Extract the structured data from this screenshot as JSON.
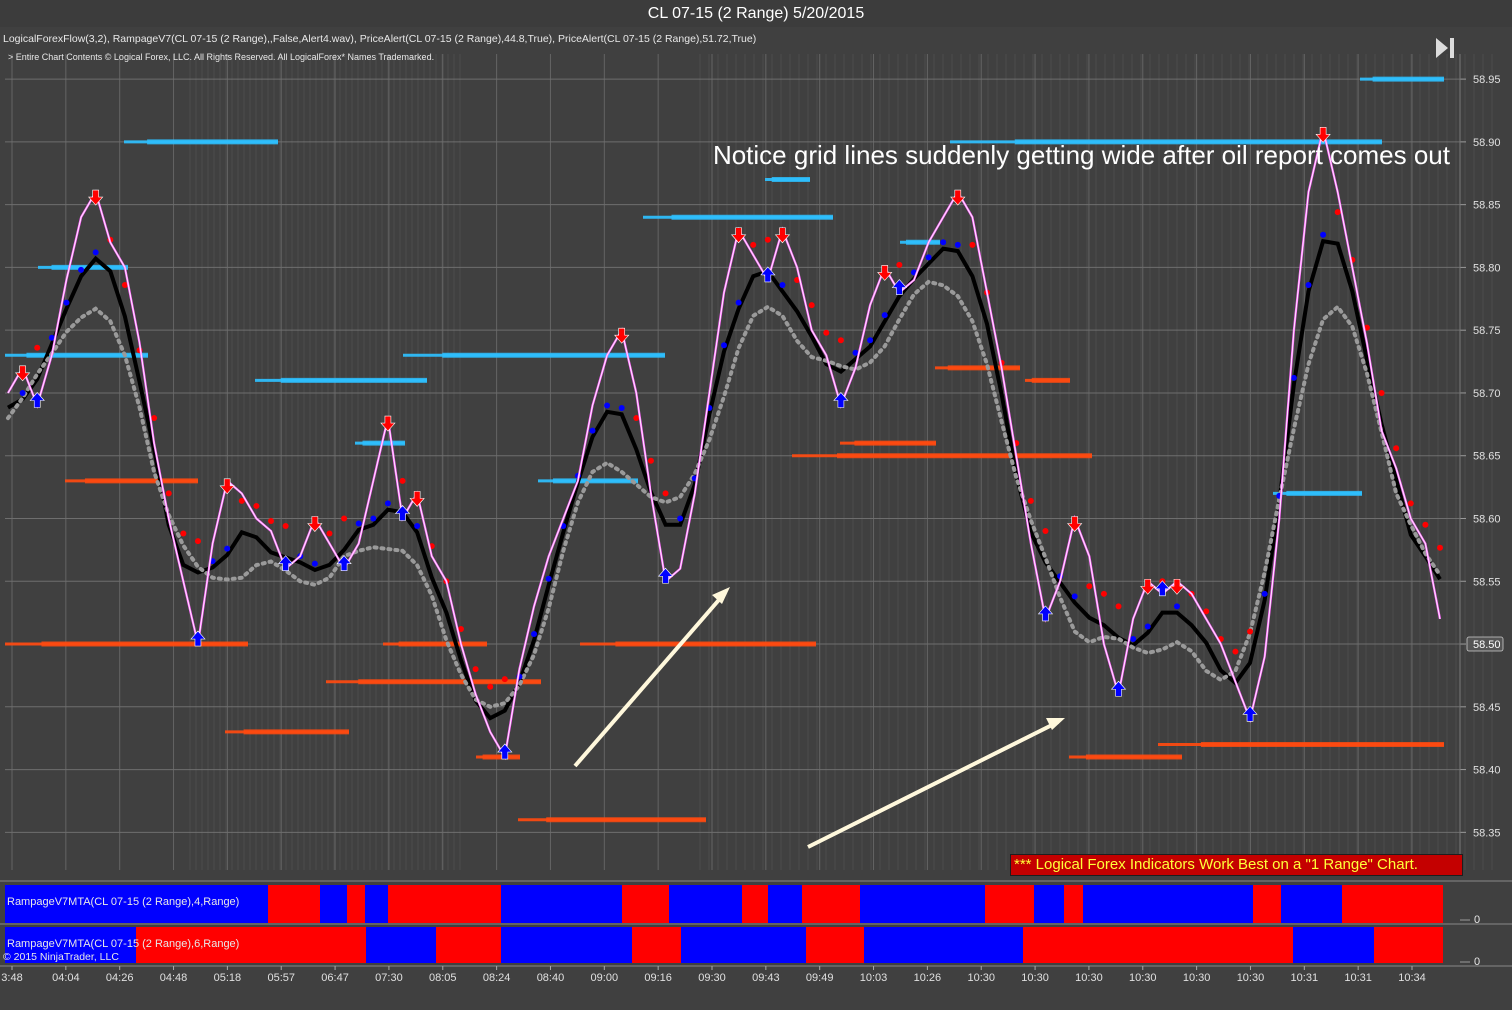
{
  "window": {
    "title": "CL 07-15 (2 Range)  5/20/2015"
  },
  "header": {
    "indicator_line": "LogicalForexFlow(3,2), RampageV7(CL 07-15 (2 Range),,False,Alert4.wav), PriceAlert(CL 07-15 (2 Range),44.8,True), PriceAlert(CL 07-15 (2 Range),51.72,True)",
    "copyright_line": "> Entire Chart Contents © Logical Forex, LLC. All Rights Reserved. All LogicalForex* Names Trademarked."
  },
  "annotation": "Notice grid lines suddenly getting wide after oil report comes out",
  "promo_banner": "*** Logical Forex Indicators Work Best on a \"1 Range\" Chart.",
  "panels": {
    "mta4_label": "RampageV7MTA(CL 07-15 (2 Range),4,Range)",
    "mta6_label": "RampageV7MTA(CL 07-15 (2 Range),6,Range)",
    "ninja_credit": "© 2015 NinjaTrader, LLC",
    "zero_label_top": "0",
    "zero_label_bottom": "0"
  },
  "colors": {
    "background": "#404040",
    "grid": "#6e6e6e",
    "price": "#ff66ff",
    "bull": "#0000ff",
    "bear": "#ff0000",
    "trend": "#000000",
    "level_blue": "#2ec0ff",
    "level_red": "#ff4a10",
    "arrow_annotation": "#fff8dc"
  },
  "chart_data": {
    "type": "line",
    "title": "CL 07-15 (2 Range)  5/20/2015",
    "ylim": [
      58.32,
      58.97
    ],
    "y_ticks": [
      58.35,
      58.4,
      58.45,
      58.5,
      58.55,
      58.6,
      58.65,
      58.7,
      58.75,
      58.8,
      58.85,
      58.9,
      58.95
    ],
    "y_tick_labels": [
      "58.35",
      "58.40",
      "58.45",
      "58.50",
      "58.55",
      "58.60",
      "58.65",
      "58.70",
      "58.75",
      "58.80",
      "58.85",
      "58.90",
      "58.95"
    ],
    "current_price": "58.50",
    "x_ticks": [
      "3:48",
      "04:04",
      "04:26",
      "04:48",
      "05:18",
      "05:57",
      "06:47",
      "07:30",
      "08:05",
      "08:24",
      "08:40",
      "09:00",
      "09:16",
      "09:30",
      "09:43",
      "09:49",
      "10:03",
      "10:26",
      "10:30",
      "10:30",
      "10:30",
      "10:30",
      "10:30",
      "10:30",
      "10:31",
      "10:31",
      "10:34"
    ],
    "series": [
      {
        "name": "",
        "values": [
          58.7,
          58.72,
          58.69,
          58.73,
          58.79,
          58.84,
          58.86,
          58.82,
          58.8,
          58.74,
          58.66,
          58.6,
          58.55,
          58.5,
          58.58,
          58.63,
          58.62,
          58.6,
          58.59,
          58.56,
          58.57,
          58.6,
          58.58,
          58.56,
          58.58,
          58.63,
          58.68,
          58.6,
          58.62,
          58.57,
          58.55,
          58.5,
          58.46,
          58.43,
          58.41,
          58.48,
          58.53,
          58.57,
          58.6,
          58.63,
          58.69,
          58.73,
          58.75,
          58.7,
          58.62,
          58.55,
          58.56,
          58.62,
          58.7,
          58.78,
          58.83,
          58.81,
          58.79,
          58.83,
          58.8,
          58.75,
          58.73,
          58.69,
          58.72,
          58.77,
          58.8,
          58.78,
          58.79,
          58.82,
          58.84,
          58.86,
          58.84,
          58.78,
          58.72,
          58.65,
          58.58,
          58.52,
          58.55,
          58.6,
          58.57,
          58.5,
          58.46,
          58.52,
          58.55,
          58.54,
          58.55,
          58.54,
          58.52,
          58.5,
          58.47,
          58.44,
          58.49,
          58.6,
          58.75,
          58.86,
          58.91,
          58.86,
          58.8,
          58.74,
          58.67,
          58.64,
          58.6,
          58.58,
          58.52
        ]
      }
    ],
    "price_levels": [
      {
        "value": 58.95,
        "color": "blue"
      },
      {
        "value": 58.9,
        "color": "blue"
      },
      {
        "value": 58.9,
        "color": "blue"
      },
      {
        "value": 58.87,
        "color": "blue"
      },
      {
        "value": 58.84,
        "color": "blue"
      },
      {
        "value": 58.82,
        "color": "blue"
      },
      {
        "value": 58.8,
        "color": "blue"
      },
      {
        "value": 58.73,
        "color": "blue"
      },
      {
        "value": 58.73,
        "color": "blue"
      },
      {
        "value": 58.71,
        "color": "blue"
      },
      {
        "value": 58.66,
        "color": "blue"
      },
      {
        "value": 58.63,
        "color": "blue"
      },
      {
        "value": 58.62,
        "color": "blue"
      },
      {
        "value": 58.72,
        "color": "red"
      },
      {
        "value": 58.71,
        "color": "red"
      },
      {
        "value": 58.66,
        "color": "red"
      },
      {
        "value": 58.65,
        "color": "red"
      },
      {
        "value": 58.63,
        "color": "red"
      },
      {
        "value": 58.5,
        "color": "red"
      },
      {
        "value": 58.5,
        "color": "red"
      },
      {
        "value": 58.5,
        "color": "red"
      },
      {
        "value": 58.47,
        "color": "red"
      },
      {
        "value": 58.43,
        "color": "red"
      },
      {
        "value": 58.42,
        "color": "red"
      },
      {
        "value": 58.41,
        "color": "red"
      },
      {
        "value": 58.41,
        "color": "red"
      },
      {
        "value": 58.36,
        "color": "red"
      }
    ],
    "mta_4_range": [
      "blue",
      "red",
      "blue",
      "red",
      "blue",
      "red",
      "blue",
      "red",
      "blue",
      "red",
      "blue",
      "red",
      "blue",
      "red",
      "blue",
      "red",
      "blue",
      "red",
      "blue",
      "red",
      "blue",
      "red"
    ],
    "mta_6_range": [
      "blue",
      "red",
      "blue",
      "red",
      "blue",
      "red",
      "blue",
      "red",
      "blue",
      "red",
      "blue",
      "red",
      "blue",
      "red"
    ]
  }
}
